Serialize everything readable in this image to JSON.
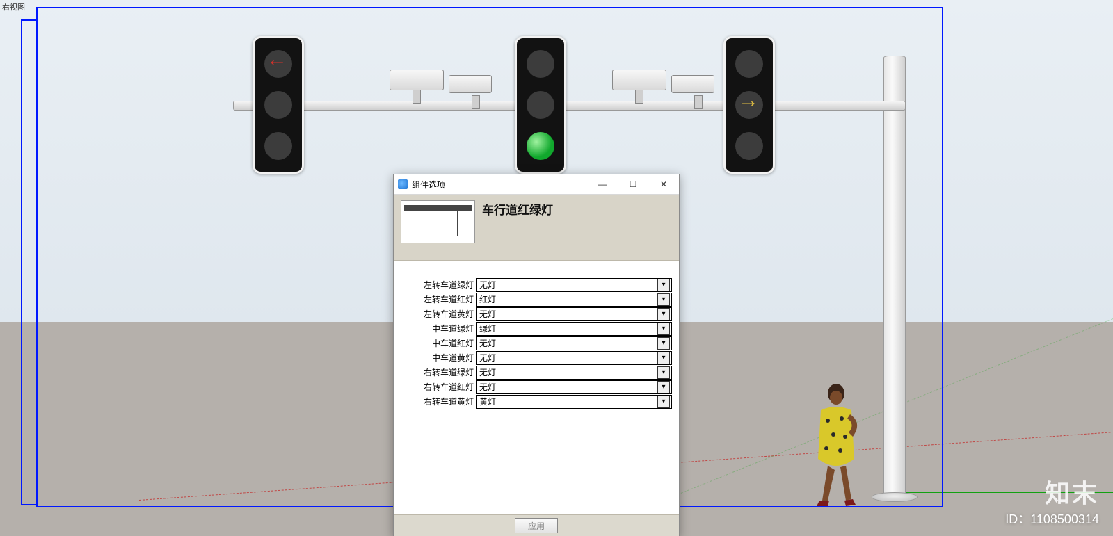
{
  "viewport": {
    "label": "右视图"
  },
  "overlay": {
    "brand": "知末",
    "id_label": "ID：1108500314"
  },
  "dialog": {
    "window_title": "组件选项",
    "heading": "车行道红绿灯",
    "apply_label": "应用",
    "options": [
      {
        "label": "左转车道绿灯",
        "value": "无灯"
      },
      {
        "label": "左转车道红灯",
        "value": "红灯"
      },
      {
        "label": "左转车道黄灯",
        "value": "无灯"
      },
      {
        "label": "中车道绿灯",
        "value": "绿灯"
      },
      {
        "label": "中车道红灯",
        "value": "无灯"
      },
      {
        "label": "中车道黄灯",
        "value": "无灯"
      },
      {
        "label": "右转车道绿灯",
        "value": "无灯"
      },
      {
        "label": "右转车道红灯",
        "value": "无灯"
      },
      {
        "label": "右转车道黄灯",
        "value": "黄灯"
      }
    ]
  },
  "scene": {
    "left_light": {
      "top": "红灯(左箭头)",
      "mid": "无灯",
      "bottom": "无灯"
    },
    "mid_light": {
      "top": "无灯",
      "mid": "无灯",
      "bottom": "绿灯"
    },
    "right_light": {
      "top": "无灯",
      "mid": "黄灯(右箭头)",
      "bottom": "无灯"
    }
  }
}
